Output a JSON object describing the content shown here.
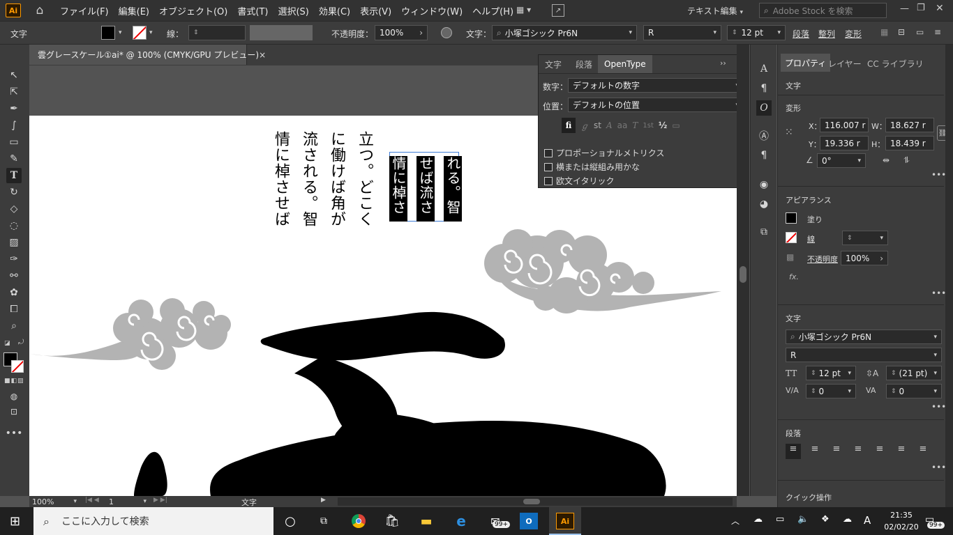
{
  "app": {
    "logo": "Ai",
    "home_icon": "home-icon"
  },
  "menu": [
    "ファイル(F)",
    "編集(E)",
    "オブジェクト(O)",
    "書式(T)",
    "選択(S)",
    "効果(C)",
    "表示(V)",
    "ウィンドウ(W)",
    "ヘルプ(H)"
  ],
  "workspace": {
    "label": "テキスト編集",
    "search_placeholder": "Adobe Stock を検索"
  },
  "control": {
    "mode": "文字",
    "stroke_label": "線：",
    "opacity_label": "不透明度：",
    "opacity_value": "100%",
    "char_label": "文字：",
    "font": "小塚ゴシック Pr6N",
    "style": "R",
    "size": "12 pt",
    "paragraph_btn": "段落",
    "align_btn": "整列",
    "transform_btn": "変形"
  },
  "document": {
    "tab_title": "雲グレースケール①ai* @ 100% (CMYK/GPU プレビュー)",
    "close": "×"
  },
  "artwork": {
    "columns1": [
      "情に棹させば",
      "流される。智",
      "に働けば角が",
      "立つ。どこく"
    ],
    "columns2": [
      "情に棹さ",
      "せば流さ",
      "れる。智"
    ]
  },
  "ot_panel": {
    "tabs": [
      "文字",
      "段落",
      "OpenType"
    ],
    "numbers_label": "数字：",
    "numbers_value": "デフォルトの数字",
    "position_label": "位置：",
    "position_value": "デフォルトの位置",
    "glyphs": [
      "fi",
      "ℊ",
      "st",
      "A",
      "aa",
      "T",
      "1st",
      "½",
      "▭"
    ],
    "checkboxes": [
      "プロポーショナルメトリクス",
      "横または縦組み用かな",
      "欧文イタリック"
    ]
  },
  "props_panel": {
    "tabs": [
      "プロパティ",
      "レイヤー",
      "CC ライブラリ"
    ],
    "section_text": "文字",
    "section_transform": "変形",
    "x_label": "X：",
    "x_value": "116.007 r",
    "y_label": "Y：",
    "y_value": "19.336 r",
    "w_label": "W：",
    "w_value": "18.627 r",
    "h_label": "H：",
    "h_value": "18.439 r",
    "angle_value": "0°",
    "section_appearance": "アピアランス",
    "fill_label": "塗り",
    "stroke_label": "線",
    "opacity_label": "不透明度",
    "opacity_value": "100%",
    "fx_label": "fx.",
    "section_character": "文字",
    "font": "小塚ゴシック Pr6N",
    "style": "R",
    "size": "12 pt",
    "leading": "(21 pt)",
    "kerning": "0",
    "tracking": "0",
    "section_paragraph": "段落",
    "section_quick": "クイック操作"
  },
  "status": {
    "zoom": "100%",
    "page": "1",
    "tool": "文字"
  },
  "taskbar": {
    "search_placeholder": "ここに入力して検索",
    "time": "21:35",
    "date": "02/02/20",
    "badge": "99+",
    "ime": "A"
  },
  "colors": {
    "chrome": "#323232",
    "panel": "#3c3c3c",
    "canvas": "#535353",
    "cloud": "#b3b3b3",
    "accent": "#ff9a00"
  }
}
